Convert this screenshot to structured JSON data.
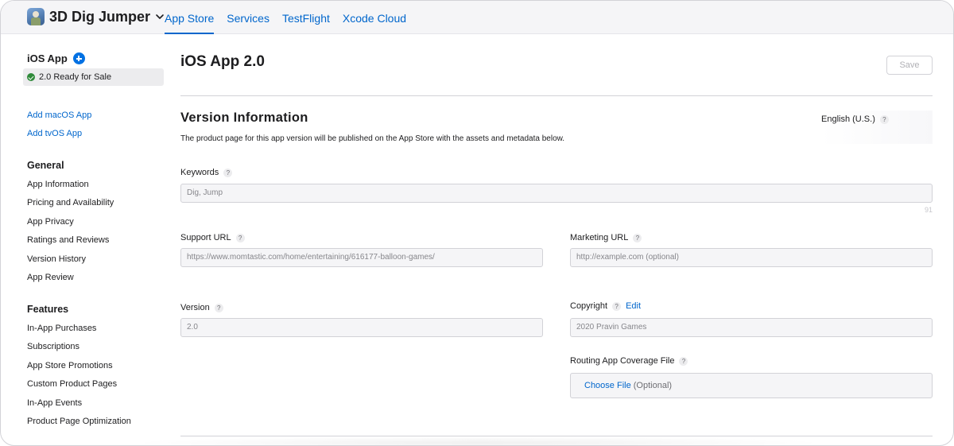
{
  "app": {
    "name": "3D Dig Jumper",
    "icon": "game-app-icon"
  },
  "topnav": [
    {
      "label": "App Store",
      "active": true
    },
    {
      "label": "Services",
      "active": false
    },
    {
      "label": "TestFlight",
      "active": false
    },
    {
      "label": "Xcode Cloud",
      "active": false
    }
  ],
  "sidebar": {
    "platform_title": "iOS App",
    "status": "2.0 Ready for Sale",
    "add_links": [
      "Add macOS App",
      "Add tvOS App"
    ],
    "general_title": "General",
    "general_items": [
      "App Information",
      "Pricing and Availability",
      "App Privacy",
      "Ratings and Reviews",
      "Version History",
      "App Review"
    ],
    "features_title": "Features",
    "features_items": [
      "In-App Purchases",
      "Subscriptions",
      "App Store Promotions",
      "Custom Product Pages",
      "In-App Events",
      "Product Page Optimization"
    ]
  },
  "main": {
    "title": "iOS App 2.0",
    "save_label": "Save",
    "section_title": "Version Information",
    "language": "English (U.S.)",
    "description": "The product page for this app version will be published on the App Store with the assets and metadata below.",
    "keywords": {
      "label": "Keywords",
      "value": "Dig, Jump",
      "remaining": "91"
    },
    "support_url": {
      "label": "Support URL",
      "value": "https://www.momtastic.com/home/entertaining/616177-balloon-games/"
    },
    "marketing_url": {
      "label": "Marketing URL",
      "placeholder": "http://example.com (optional)"
    },
    "version": {
      "label": "Version",
      "value": "2.0"
    },
    "copyright": {
      "label": "Copyright",
      "edit_label": "Edit",
      "value": "2020 Pravin Games"
    },
    "routing": {
      "label": "Routing App Coverage File",
      "choose_label": "Choose File",
      "optional_label": "(Optional)"
    },
    "help_glyph": "?"
  },
  "colors": {
    "link": "#0066cc",
    "accent": "#0071e3",
    "success": "#2f8a3a"
  }
}
